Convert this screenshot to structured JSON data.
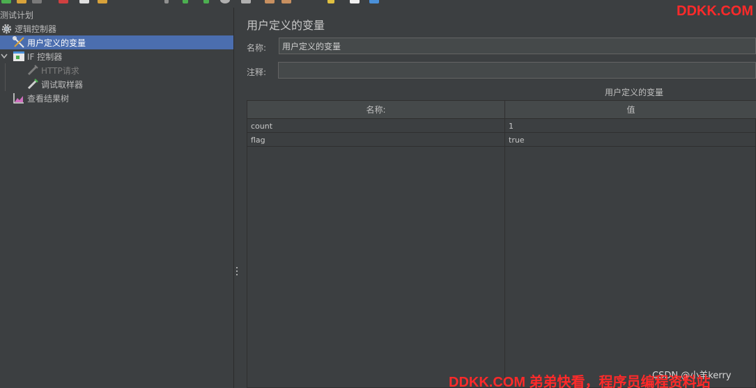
{
  "tree": {
    "items": [
      {
        "label": "测试计划",
        "icon": "test-plan-icon"
      },
      {
        "label": "逻辑控制器",
        "icon": "gear-icon"
      },
      {
        "label": "用户定义的变量",
        "icon": "wrench-icon",
        "selected": true
      },
      {
        "label": "IF 控制器",
        "icon": "if-controller-icon",
        "expanded": true
      },
      {
        "label": "HTTP请求",
        "icon": "pipette-icon",
        "disabled": true
      },
      {
        "label": "调试取样器",
        "icon": "pipette-icon"
      },
      {
        "label": "查看结果树",
        "icon": "chart-icon"
      }
    ]
  },
  "panel": {
    "title": "用户定义的变量",
    "name_label": "名称:",
    "name_value": "用户定义的变量",
    "comment_label": "注释:",
    "comment_value": "",
    "section_title": "用户定义的变量",
    "table": {
      "columns": [
        "名称:",
        "值"
      ],
      "rows": [
        {
          "name": "count",
          "value": "1"
        },
        {
          "name": "flag",
          "value": "true"
        }
      ]
    }
  },
  "watermarks": {
    "top": "DDKK.COM",
    "csdn": "CSDN @小羊kerry",
    "bottom": "DDKK.COM 弟弟快看，程序员编程资料站"
  },
  "colors": {
    "background": "#3c3f41",
    "selection": "#4b6eaf",
    "watermark": "#ff2a2a"
  }
}
